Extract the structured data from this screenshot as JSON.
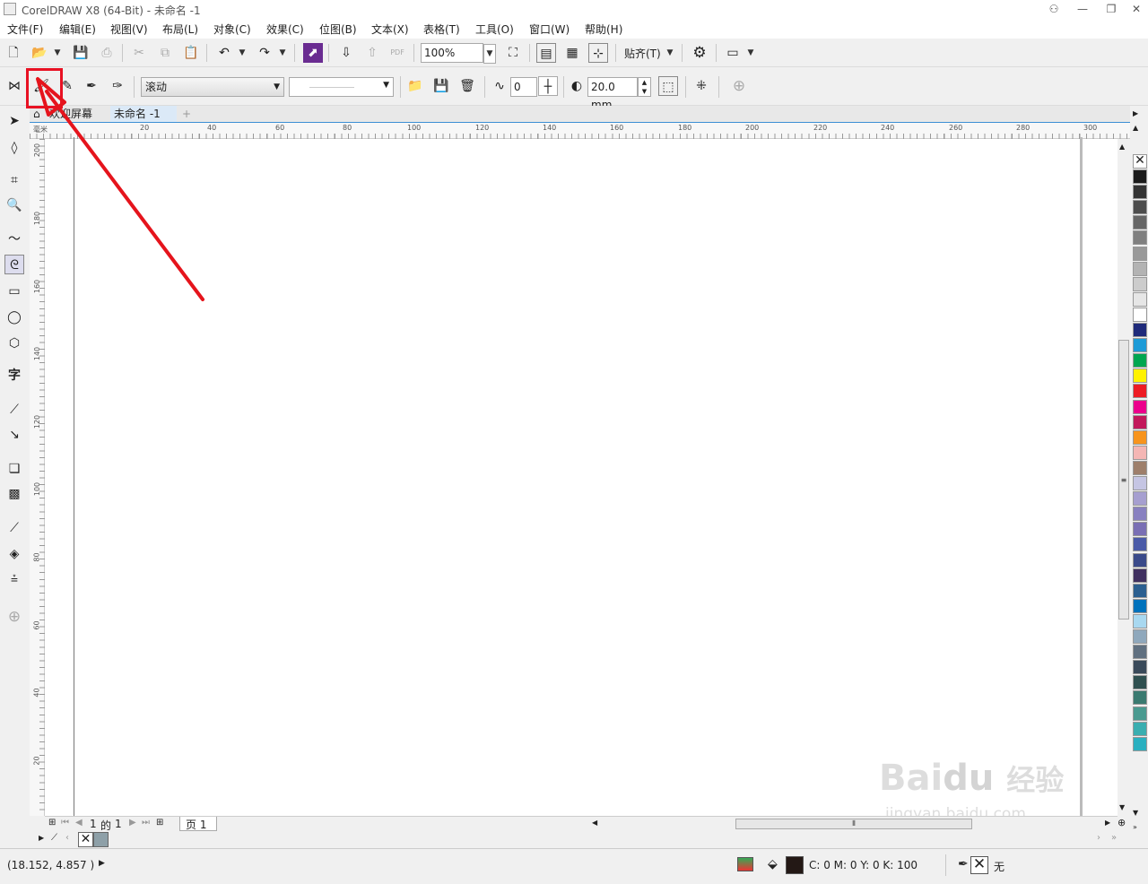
{
  "window": {
    "title": "CorelDRAW X8 (64-Bit) - 未命名 -1"
  },
  "menu": [
    "文件(F)",
    "编辑(E)",
    "视图(V)",
    "布局(L)",
    "对象(C)",
    "效果(C)",
    "位图(B)",
    "文本(X)",
    "表格(T)",
    "工具(O)",
    "窗口(W)",
    "帮助(H)"
  ],
  "toolbar": {
    "zoom": "100%",
    "snap": "贴齐(T)",
    "pdf": "PDF"
  },
  "propbar": {
    "mode": "滚动",
    "smoothing": "0",
    "width": "20.0 mm"
  },
  "tabs": {
    "welcome": "欢迎屏幕",
    "doc": "未命名 -1"
  },
  "hruler": [
    "20",
    "40",
    "60",
    "80",
    "100",
    "120",
    "140",
    "160",
    "180",
    "200",
    "220",
    "240",
    "260",
    "280",
    "300"
  ],
  "vruler": [
    "200",
    "180",
    "160",
    "140",
    "120",
    "100",
    "80",
    "60",
    "40",
    "20"
  ],
  "rulerunit": "毫米",
  "pagenav": {
    "current": "1",
    "of": "的",
    "total": "1",
    "page_tab": "页 1"
  },
  "status": {
    "coords": "(18.152, 4.857 )",
    "fill": "C: 0 M: 0 Y: 0 K: 100",
    "outline": "无"
  },
  "watermark": {
    "brand": "Bai",
    "brand2": "du",
    "cn": "经验",
    "url": "jingyan.baidu.com"
  },
  "palette": [
    "#1a1a1a",
    "#333333",
    "#4d4d4d",
    "#666666",
    "#808080",
    "#999999",
    "#b3b3b3",
    "#cccccc",
    "#e6e6e6",
    "#ffffff",
    "#1f2a7a",
    "#1e9bd7",
    "#00a650",
    "#fff200",
    "#ed1c24",
    "#ec008c",
    "#c2185b",
    "#f7941d",
    "#f4b6b4",
    "#9e7f6b",
    "#c5c5e3",
    "#a69fd0",
    "#8880c0",
    "#7a6fb4",
    "#4a5aa8",
    "#3a4a8a",
    "#403060",
    "#2b5f90",
    "#0072bc",
    "#a8d8f0",
    "#8fa8bc",
    "#607080",
    "#3a4a5a",
    "#2f5050",
    "#3a7a70",
    "#4a9a90",
    "#3aaeb0",
    "#2ab0c0"
  ],
  "colors": {
    "accent": "#3c8fd4",
    "highlight": "#e81123",
    "arrow": "#e5141c"
  }
}
